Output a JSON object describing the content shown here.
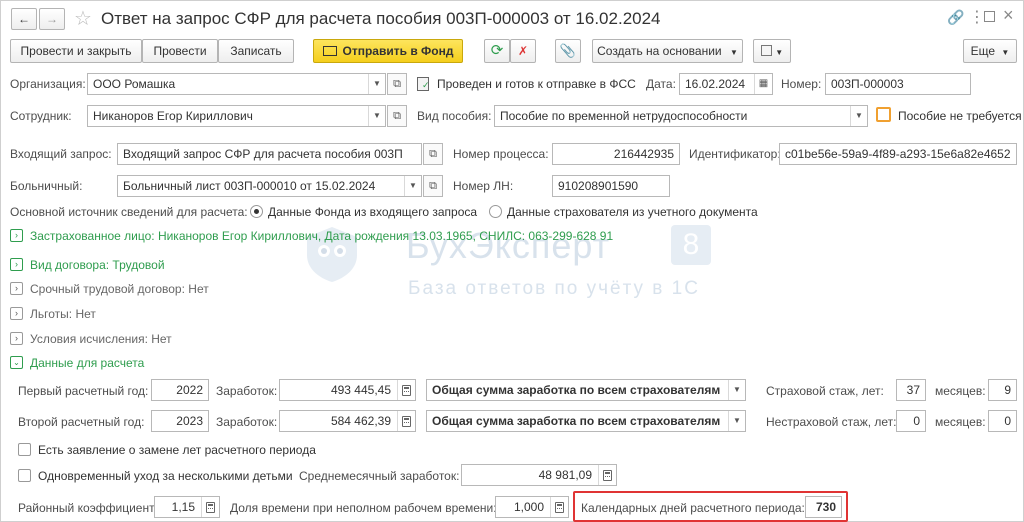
{
  "title": "Ответ на запрос СФР для расчета пособия 003П-000003 от 16.02.2024",
  "toolbar": {
    "post_close": "Провести и закрыть",
    "post": "Провести",
    "save": "Записать",
    "send": "Отправить в Фонд",
    "create_based": "Создать на основании",
    "more": "Еще"
  },
  "header": {
    "org_label": "Организация:",
    "org_value": "ООО Ромашка",
    "status_text": "Проведен и готов к отправке в ФСС",
    "date_label": "Дата:",
    "date_value": "16.02.2024",
    "number_label": "Номер:",
    "number_value": "003П-000003",
    "employee_label": "Сотрудник:",
    "employee_value": "Никаноров Егор Кириллович",
    "benefit_label": "Вид пособия:",
    "benefit_value": "Пособие по временной нетрудоспособности",
    "not_required_label": "Пособие не требуется",
    "incoming_label": "Входящий запрос:",
    "incoming_value": "Входящий запрос СФР для расчета пособия 003П",
    "process_label": "Номер процесса:",
    "process_value": "216442935",
    "identifier_label": "Идентификатор:",
    "identifier_value": "c01be56e-59a9-4f89-a293-15e6a82e4652",
    "sick_label": "Больничный:",
    "sick_value": "Больничный лист 003П-000010 от 15.02.2024",
    "ln_label": "Номер ЛН:",
    "ln_value": "910208901590"
  },
  "source": {
    "label": "Основной источник сведений для расчета:",
    "option1": "Данные Фонда из входящего запроса",
    "option2": "Данные страхователя из учетного документа"
  },
  "sections": {
    "insured": "Застрахованное лицо: Никаноров Егор Кириллович, Дата рождения 13.03.1965, СНИЛС: 063-299-628 91",
    "contract": "Вид договора: Трудовой",
    "fixed_term": "Срочный трудовой договор: Нет",
    "benefits": "Льготы: Нет",
    "conditions": "Условия исчисления: Нет",
    "calc_data": "Данные для расчета"
  },
  "calc": {
    "year1_label": "Первый расчетный год:",
    "year1_value": "2022",
    "earn_label": "Заработок:",
    "earn1_value": "493 445,45",
    "earn_type1": "Общая сумма заработка по всем страхователям",
    "ins_label": "Страховой стаж, лет:",
    "ins_years": "37",
    "months_label": "месяцев:",
    "ins_months": "9",
    "year2_label": "Второй расчетный год:",
    "year2_value": "2023",
    "earn2_value": "584 462,39",
    "earn_type2": "Общая сумма заработка по всем страхователям",
    "nonins_label": "Нестраховой стаж, лет:",
    "nonins_years": "0",
    "nonins_months": "0",
    "replace_label": "Есть заявление о замене лет расчетного периода",
    "multi_label": "Одновременный уход за несколькими детьми",
    "avg_label": "Среднемесячный заработок:",
    "avg_value": "48 981,09",
    "region_label": "Районный коэффициент:",
    "region_value": "1,15",
    "share_label": "Доля времени при неполном рабочем времени:",
    "share_value": "1,000",
    "days_label": "Календарных дней расчетного периода:",
    "days_value": "730"
  },
  "watermark": {
    "brand": "БухЭксперт",
    "brand_num": "8",
    "tagline": "База ответов по учёту в 1С"
  }
}
